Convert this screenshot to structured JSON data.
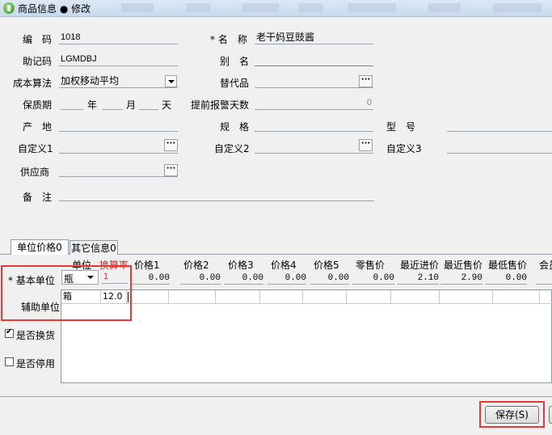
{
  "window": {
    "title": "商品信息 ● 修改"
  },
  "form": {
    "code_label": "编　码",
    "code_value": "1018",
    "name_label": "* 名　称",
    "name_value": "老干妈豆豉酱",
    "mnemonic_label": "助记码",
    "mnemonic_value": "LGMDBJ",
    "alias_label": "别　名",
    "alias_value": "",
    "cost_method_label": "成本算法",
    "cost_method_value": "加权移动平均",
    "substitute_label": "替代品",
    "substitute_value": "",
    "shelf_life_label": "保质期",
    "year_unit": "年",
    "month_unit": "月",
    "day_unit": "天",
    "alert_days_label": "提前报警天数",
    "alert_days_value": "0",
    "origin_label": "产　地",
    "origin_value": "",
    "spec_label": "规　格",
    "spec_value": "",
    "model_label": "型　号",
    "model_value": "",
    "custom1_label": "自定义1",
    "custom1_value": "",
    "custom2_label": "自定义2",
    "custom2_value": "",
    "custom3_label": "自定义3",
    "custom3_value": "",
    "supplier_label": "供应商",
    "supplier_value": "",
    "remark_label": "备　注",
    "remark_value": ""
  },
  "tabs": [
    {
      "label": "单位价格0",
      "active": true
    },
    {
      "label": "其它信息0",
      "active": false
    }
  ],
  "unit_price": {
    "base_unit_label": "* 基本单位",
    "aux_unit_label": "辅助单位",
    "unit_header": "单位",
    "rate_header": "换算率",
    "base_unit_value": "瓶",
    "base_rate_value": "1",
    "price_headers": [
      "价格1",
      "价格2",
      "价格3",
      "价格4",
      "价格5",
      "零售价",
      "最近进价",
      "最近售价",
      "最低售价",
      "会员"
    ],
    "price_values": [
      "0.00",
      "0.00",
      "0.00",
      "0.00",
      "0.00",
      "0.00",
      "2.10",
      "2.90",
      "0.00",
      ""
    ],
    "aux_rows": [
      {
        "unit": "箱",
        "rate": "12.0"
      }
    ]
  },
  "options": {
    "exchange_label": "是否换货",
    "exchange_checked": true,
    "disabled_label": "是否停用",
    "disabled_checked": false
  },
  "buttons": {
    "save_label": "保存(S)"
  },
  "colors": {
    "highlight": "#e53935",
    "rate_header": "#d32f2f"
  }
}
